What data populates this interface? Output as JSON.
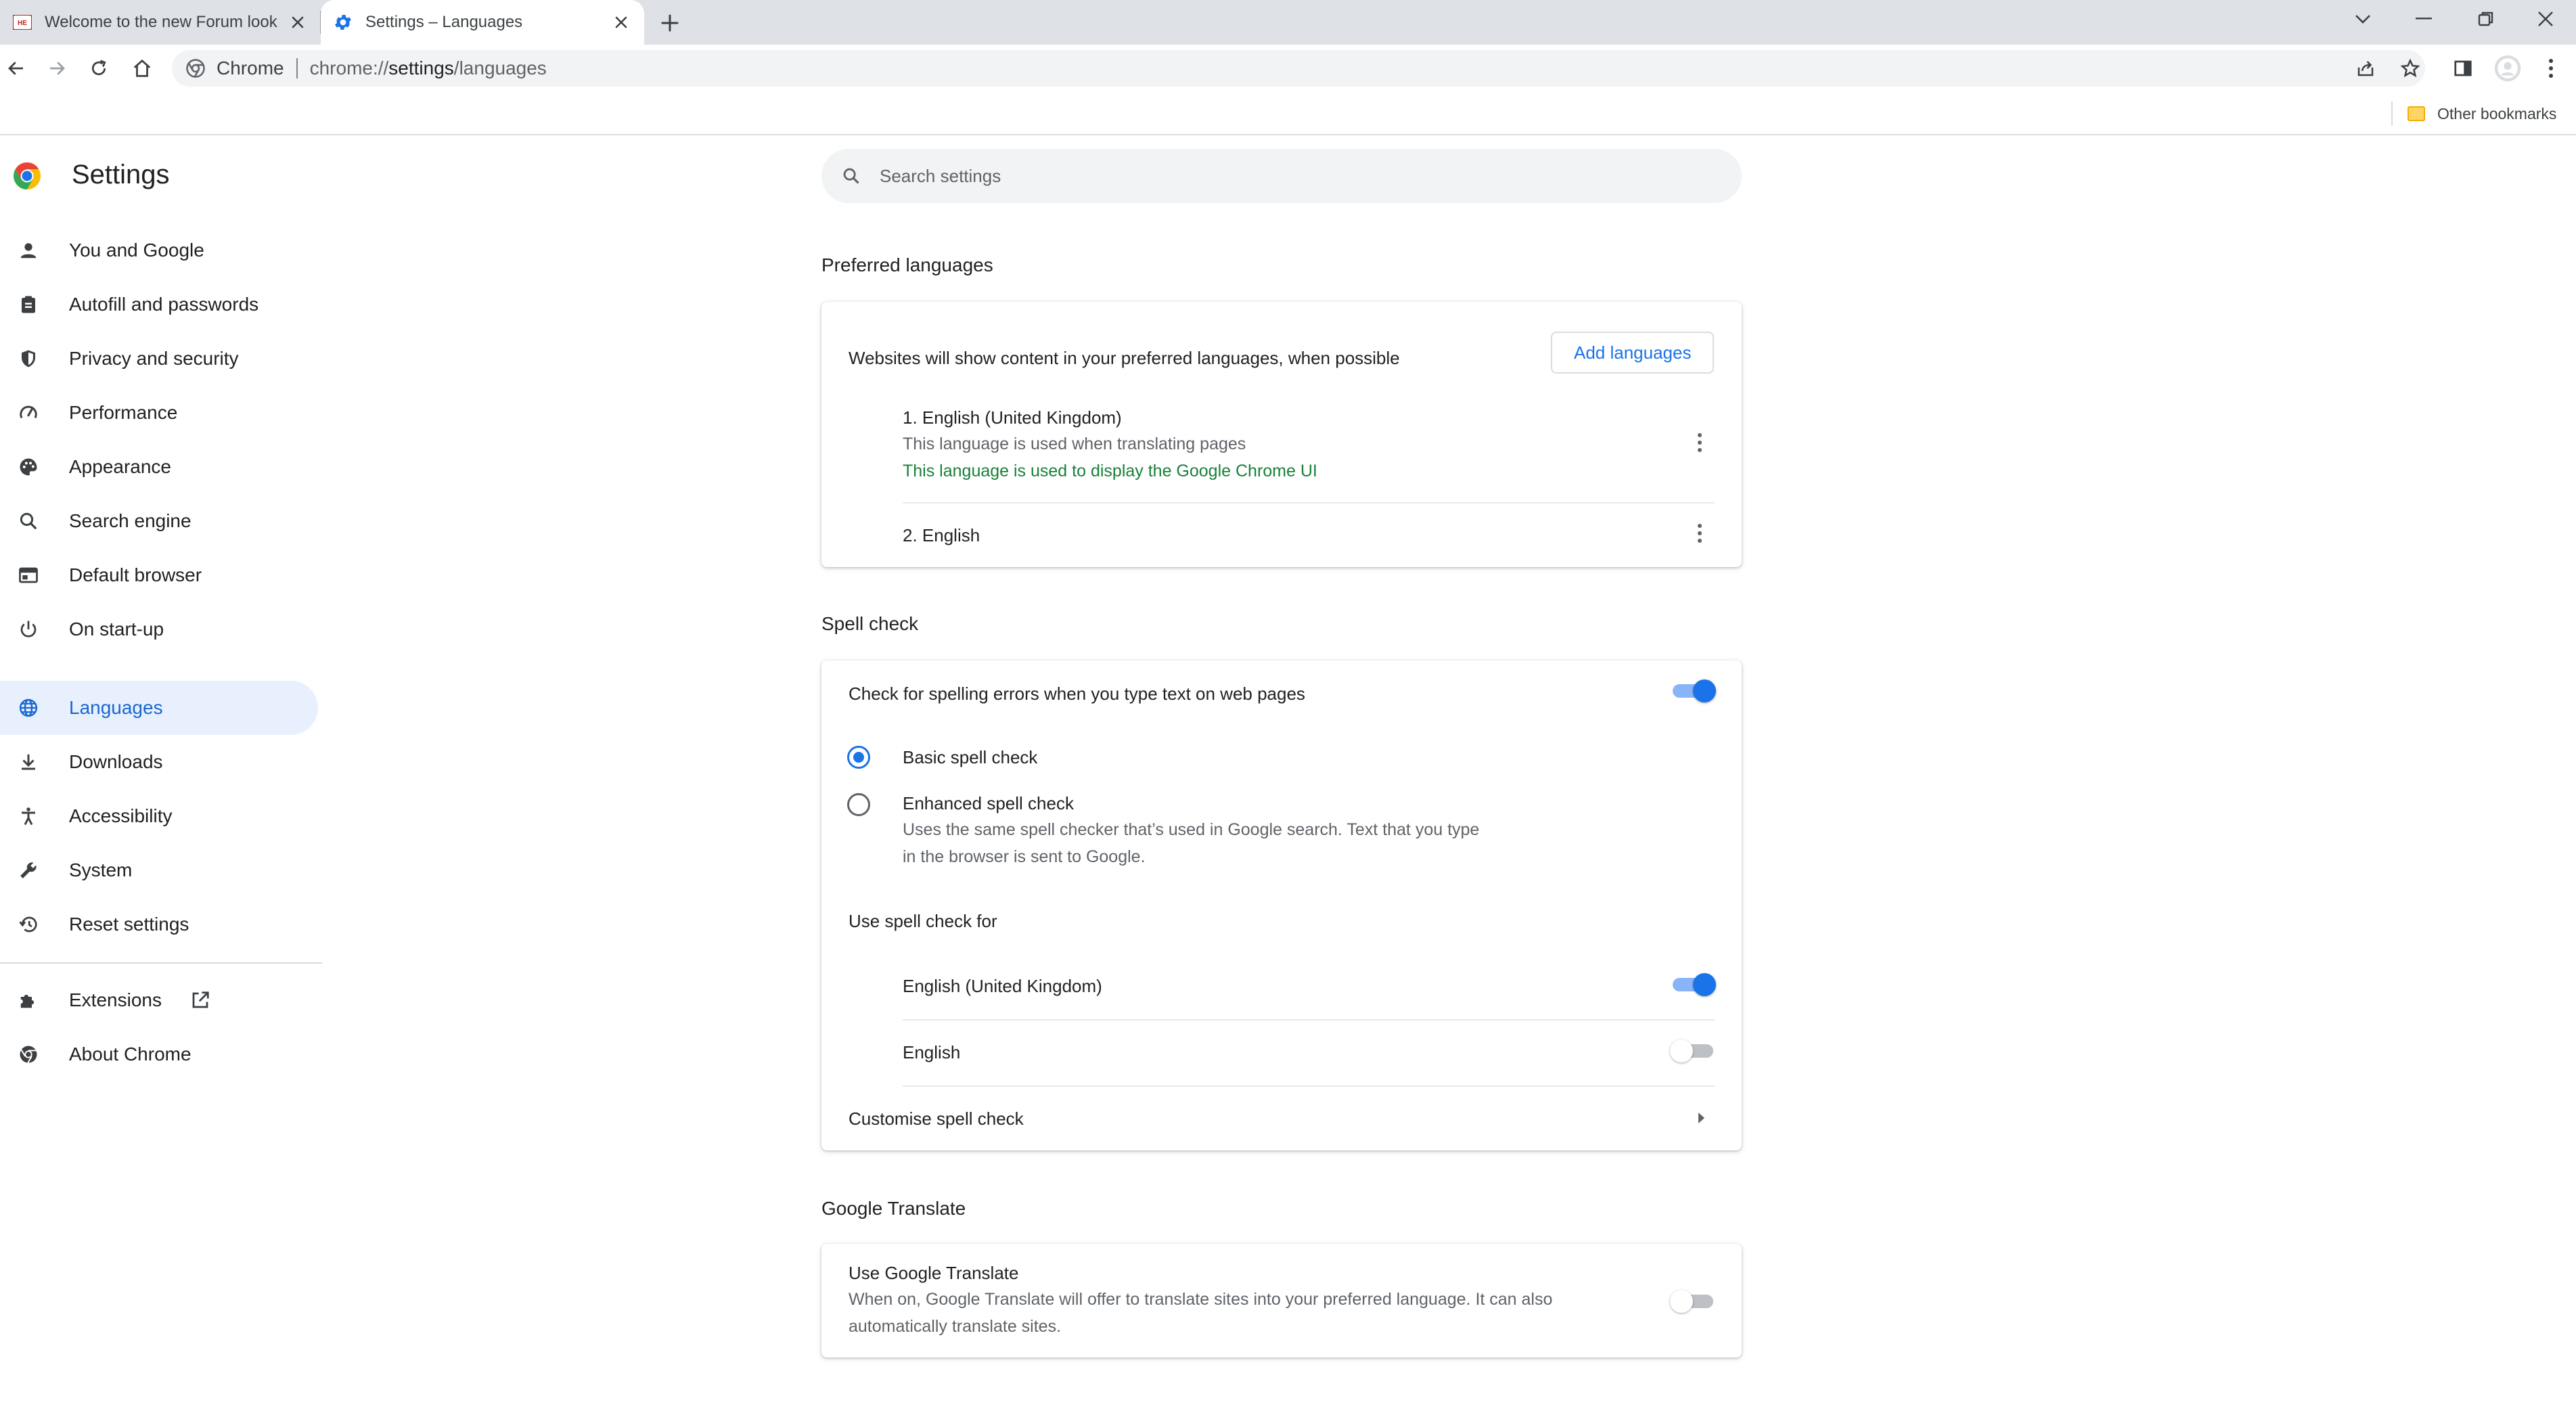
{
  "tabs": [
    {
      "title": "Welcome to the new Forum look",
      "favicon": "forum-favicon"
    },
    {
      "title": "Settings – Languages",
      "favicon": "gear-icon"
    }
  ],
  "toolbar": {
    "site_chip": "Chrome",
    "url_scheme": "chrome://",
    "url_host": "settings",
    "url_path": "/languages"
  },
  "bookmarks": {
    "other": "Other bookmarks"
  },
  "settings": {
    "title": "Settings",
    "search_placeholder": "Search settings"
  },
  "sidebar": {
    "items": [
      {
        "label": "You and Google",
        "icon": "person-icon"
      },
      {
        "label": "Autofill and passwords",
        "icon": "clipboard-icon"
      },
      {
        "label": "Privacy and security",
        "icon": "shield-icon"
      },
      {
        "label": "Performance",
        "icon": "speedometer-icon"
      },
      {
        "label": "Appearance",
        "icon": "palette-icon"
      },
      {
        "label": "Search engine",
        "icon": "search-icon"
      },
      {
        "label": "Default browser",
        "icon": "browser-window-icon"
      },
      {
        "label": "On start-up",
        "icon": "power-icon"
      },
      {
        "label": "Languages",
        "icon": "globe-icon"
      },
      {
        "label": "Downloads",
        "icon": "download-icon"
      },
      {
        "label": "Accessibility",
        "icon": "accessibility-icon"
      },
      {
        "label": "System",
        "icon": "wrench-icon"
      },
      {
        "label": "Reset settings",
        "icon": "history-icon"
      },
      {
        "label": "Extensions",
        "icon": "puzzle-icon"
      },
      {
        "label": "About Chrome",
        "icon": "chrome-icon"
      }
    ]
  },
  "preferred": {
    "section_title": "Preferred languages",
    "description": "Websites will show content in your preferred languages, when possible",
    "add_button": "Add languages",
    "languages": [
      {
        "name": "1. English (United Kingdom)",
        "note1": "This language is used when translating pages",
        "note2": "This language is used to display the Google Chrome UI"
      },
      {
        "name": "2. English"
      }
    ]
  },
  "spell": {
    "section_title": "Spell check",
    "check_label": "Check for spelling errors when you type text on web pages",
    "check_on": true,
    "basic_label": "Basic spell check",
    "enhanced_label": "Enhanced spell check",
    "enhanced_desc_1": "Uses the same spell checker that’s used in Google search. Text that you type",
    "enhanced_desc_2": "in the browser is sent to Google.",
    "selected_mode": "basic",
    "use_for_label": "Use spell check for",
    "languages": [
      {
        "name": "English (United Kingdom)",
        "on": true
      },
      {
        "name": "English",
        "on": false
      }
    ],
    "customise_label": "Customise spell check"
  },
  "translate": {
    "section_title": "Google Translate",
    "label": "Use Google Translate",
    "desc_1": "When on, Google Translate will offer to translate sites into your preferred language. It can also",
    "desc_2": "automatically translate sites.",
    "on": false
  },
  "colors": {
    "accent": "#1a73e8",
    "selected_bg": "#e8f0fe",
    "green_text": "#188038"
  }
}
